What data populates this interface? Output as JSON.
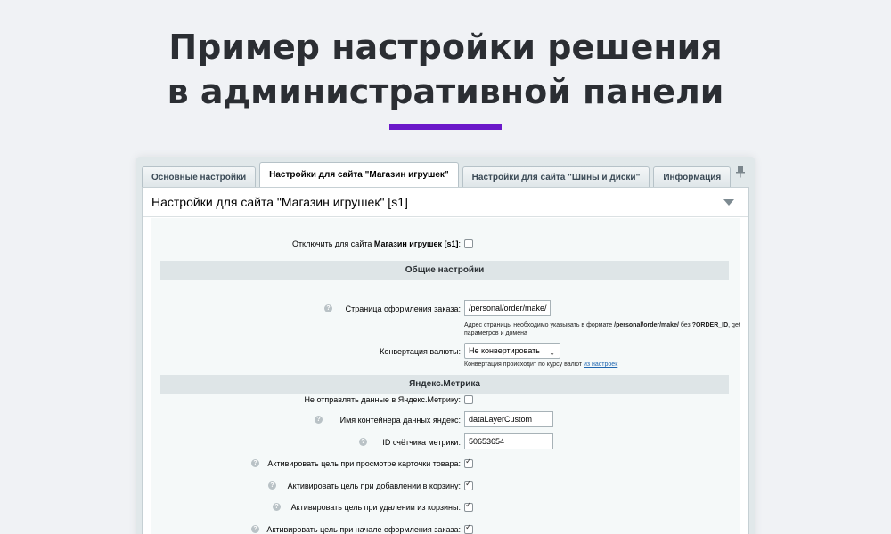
{
  "hero": {
    "title_line1": "Пример настройки решения",
    "title_line2": "в административной панели",
    "accent_color": "#6b18c9"
  },
  "tabs": [
    {
      "label": "Основные настройки",
      "active": false
    },
    {
      "label": "Настройки для сайта \"Магазин игрушек\"",
      "active": true
    },
    {
      "label": "Настройки для сайта \"Шины и диски\"",
      "active": false
    },
    {
      "label": "Информация",
      "active": false
    }
  ],
  "panel": {
    "header": "Настройки для сайта \"Магазин игрушек\" [s1]",
    "pin_icon": "pin-icon",
    "collapse_icon": "triangle-down-icon"
  },
  "form": {
    "disable_site": {
      "prefix": "Отключить для сайта ",
      "site": "Магазин игрушек [s1]",
      "suffix": ":",
      "checked": false
    },
    "general_section": "Общие настройки",
    "order_page": {
      "label": "Страница оформления заказа:",
      "value": "/personal/order/make/",
      "note_prefix": "Адрес страницы необходимо указывать в формате ",
      "note_bold": "/personal/order/make/",
      "note_mid": " без ",
      "note_bold2": "?ORDER_ID",
      "note_suffix": ", get параметров и домена"
    },
    "currency": {
      "label": "Конвертация валюты:",
      "selected": "Не конвертировать",
      "note_prefix": "Конвертация происходит по курсу валют ",
      "note_link": "из настроек"
    },
    "metrika_section": "Яндекс.Метрика",
    "metrika_disable": {
      "label": "Не отправлять данные в Яндекс.Метрику:",
      "checked": false
    },
    "container_name": {
      "label": "Имя контейнера данных яндекс:",
      "value": "dataLayerCustom"
    },
    "counter_id": {
      "label": "ID счётчика метрики:",
      "value": "50653654"
    },
    "goals": [
      {
        "label": "Активировать цель при просмотре карточки товара:",
        "checked": true
      },
      {
        "label": "Активировать цель при добавлении в корзину:",
        "checked": true
      },
      {
        "label": "Активировать цель при удалении из корзины:",
        "checked": true
      },
      {
        "label": "Активировать цель при начале оформления заказа:",
        "checked": true
      }
    ],
    "hint_glyph": "?"
  }
}
